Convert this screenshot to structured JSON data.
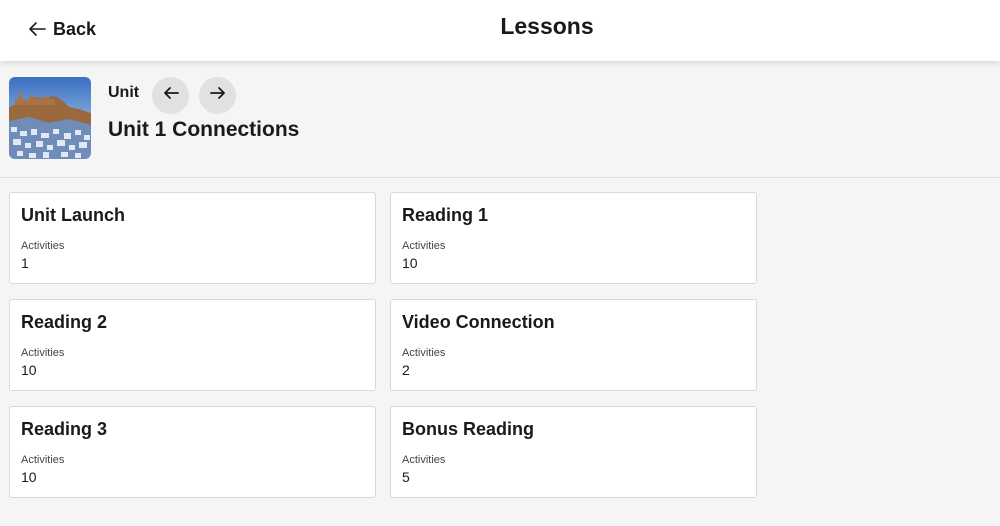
{
  "header": {
    "back_label": "Back",
    "title": "Lessons"
  },
  "unit": {
    "label": "Unit",
    "title": "Unit 1 Connections",
    "prev_icon": "arrow-left-icon",
    "next_icon": "arrow-right-icon"
  },
  "lessons": [
    {
      "title": "Unit Launch",
      "activities_label": "Activities",
      "activities_count": "1"
    },
    {
      "title": "Reading 1",
      "activities_label": "Activities",
      "activities_count": "10"
    },
    {
      "title": "Reading 2",
      "activities_label": "Activities",
      "activities_count": "10"
    },
    {
      "title": "Video Connection",
      "activities_label": "Activities",
      "activities_count": "2"
    },
    {
      "title": "Reading 3",
      "activities_label": "Activities",
      "activities_count": "10"
    },
    {
      "title": "Bonus Reading",
      "activities_label": "Activities",
      "activities_count": "5"
    }
  ],
  "colors": {
    "background": "#f5f5f5",
    "surface": "#ffffff",
    "nav_button": "#e1e1e1"
  }
}
